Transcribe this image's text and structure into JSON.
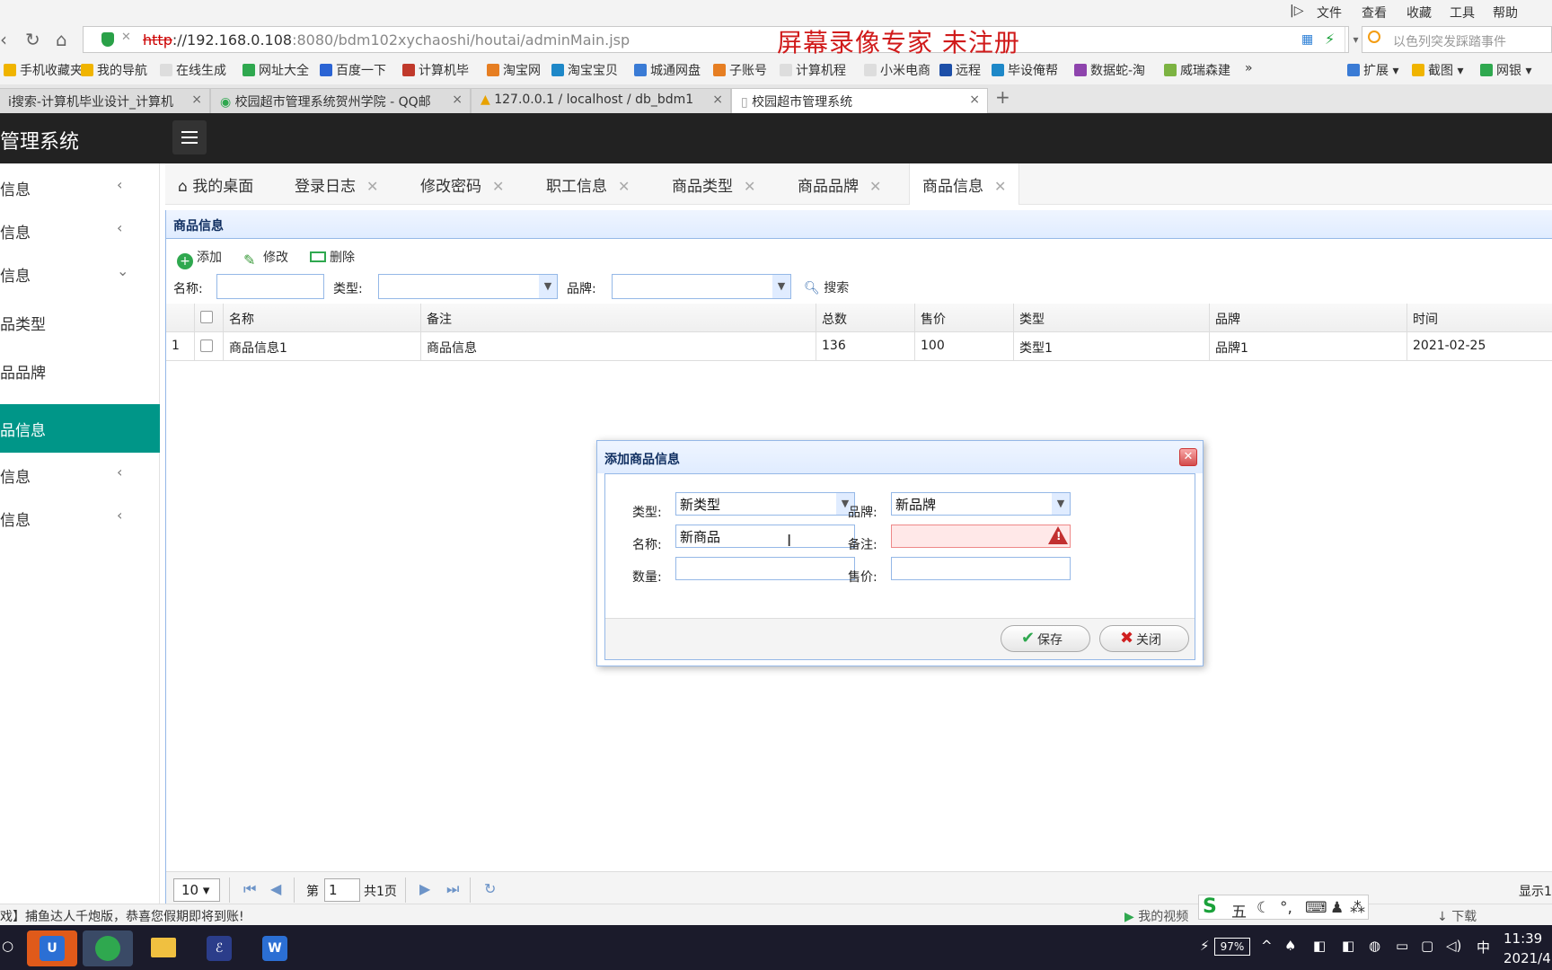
{
  "browser": {
    "menu": [
      "文件",
      "查看",
      "收藏",
      "工具",
      "帮助"
    ],
    "url_scheme": "http",
    "url_host": "://192.168.0.108",
    "url_rest": ":8080/bdm102xychaoshi/houtai/adminMain.jsp",
    "watermark": "屏幕录像专家  未注册",
    "search_placeholder": "以色列突发踩踏事件",
    "bookmarks": [
      "手机收藏夹",
      "我的导航",
      "在线生成",
      "网址大全",
      "百度一下",
      "计算机毕",
      "淘宝网",
      "淘宝宝贝",
      "城通网盘",
      "子账号",
      "计算机程",
      "小米电商",
      "远程",
      "毕设俺帮",
      "数据蛇-淘",
      "威瑞森建",
      "»"
    ],
    "bookmarks_right": [
      "扩展",
      "截图",
      "网银"
    ],
    "tabs": [
      "i搜索-计算机毕业设计_计算机",
      "校园超市管理系统贺州学院 - QQ邮",
      "127.0.0.1 / localhost / db_bdm1",
      "校园超市管理系统"
    ],
    "newtab": "+"
  },
  "app": {
    "title": "超市管理系统",
    "sidebar": [
      {
        "label": "职工信息",
        "arrow": "‹"
      },
      {
        "label": "用户信息",
        "arrow": "‹"
      },
      {
        "label": "商品信息",
        "arrow": "⌄"
      },
      {
        "label": "商品类型",
        "arrow": ""
      },
      {
        "label": "商品品牌",
        "arrow": ""
      },
      {
        "label": "商品信息",
        "arrow": ""
      },
      {
        "label": "销售信息",
        "arrow": "‹"
      },
      {
        "label": "库存信息",
        "arrow": "‹"
      }
    ],
    "content_tabs": [
      "我的桌面",
      "登录日志",
      "修改密码",
      "职工信息",
      "商品类型",
      "商品品牌",
      "商品信息"
    ],
    "panel_title": "商品信息",
    "toolbar": {
      "add": "添加",
      "edit": "修改",
      "delete": "删除"
    },
    "filter": {
      "name_label": "名称:",
      "type_label": "类型:",
      "brand_label": "品牌:",
      "search": "搜索"
    },
    "grid": {
      "columns": [
        "名称",
        "备注",
        "总数",
        "售价",
        "类型",
        "品牌",
        "时间"
      ],
      "rows": [
        {
          "index": "1",
          "cells": [
            "商品信息1",
            "商品信息",
            "136",
            "100",
            "类型1",
            "品牌1",
            "2021-02-25"
          ]
        }
      ]
    },
    "pager": {
      "page_size": "10",
      "page_prefix": "第",
      "page_value": "1",
      "page_total": "共1页",
      "display": "显示1"
    }
  },
  "dialog": {
    "title": "添加商品信息",
    "type_label": "类型:",
    "type_value": "新类型",
    "brand_label": "品牌:",
    "brand_value": "新品牌",
    "name_label": "名称:",
    "name_value": "新商品",
    "note_label": "备注:",
    "note_value": "",
    "qty_label": "数量:",
    "qty_value": "",
    "price_label": "售价:",
    "price_value": "",
    "save": "保存",
    "close": "关闭"
  },
  "status": {
    "news": "戏】捕鱼达人千炮版，恭喜您假期即将到账!",
    "my_video": "我的视频",
    "download": "下载",
    "ime_mode": "五",
    "battery": "97%",
    "tray_lang": "中",
    "time": "11:39",
    "date": "2021/4"
  },
  "colors": {
    "accent": "#009688",
    "header": "#222222",
    "border": "#95b8e7"
  }
}
